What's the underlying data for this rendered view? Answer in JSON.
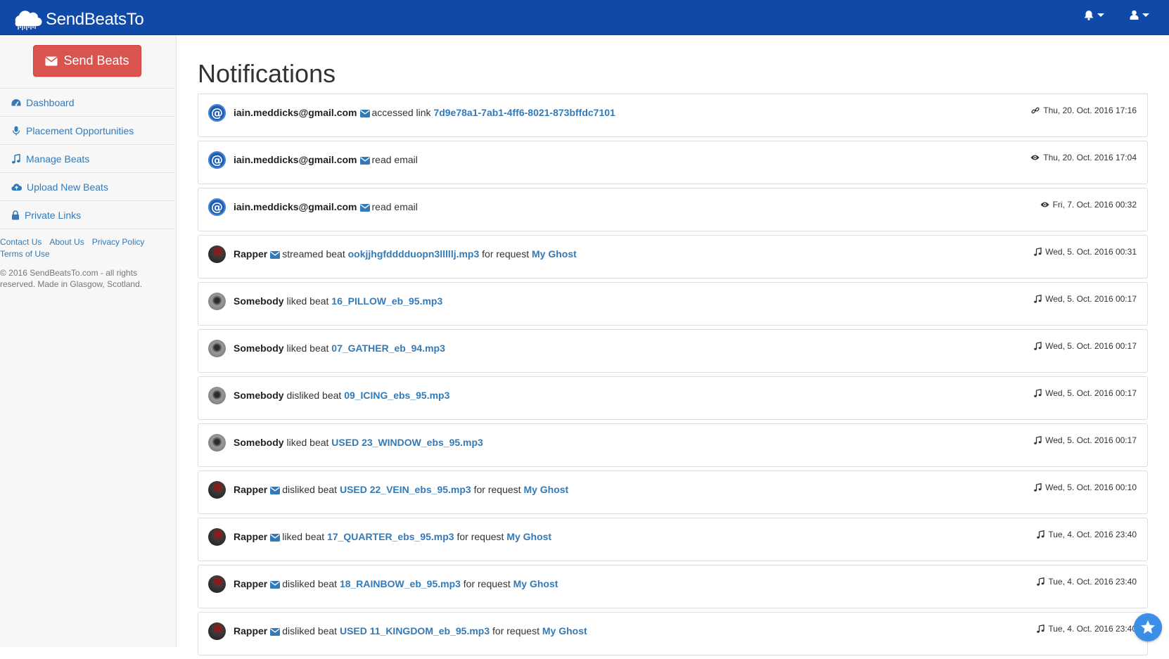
{
  "brand": {
    "name": "SendBeatsTo"
  },
  "topnav": {
    "notifications_icon": "bell-icon",
    "user_icon": "user-icon"
  },
  "sidebar": {
    "send_button": "Send Beats",
    "items": [
      {
        "label": "Dashboard",
        "icon": "dashboard-icon"
      },
      {
        "label": "Placement Opportunities",
        "icon": "microphone-icon"
      },
      {
        "label": "Manage Beats",
        "icon": "music-icon"
      },
      {
        "label": "Upload New Beats",
        "icon": "cloud-upload-icon"
      },
      {
        "label": "Private Links",
        "icon": "lock-icon"
      }
    ],
    "footer_links": [
      "Contact Us",
      "About Us",
      "Privacy Policy",
      "Terms of Use"
    ],
    "copyright": "© 2016 SendBeatsTo.com - all rights reserved. Made in Glasgow, Scotland."
  },
  "page": {
    "title": "Notifications"
  },
  "notifications": [
    {
      "avatar": "at",
      "user": "iain.meddicks@gmail.com",
      "mail": true,
      "action": "accessed link",
      "target": "7d9e78a1-7ab1-4ff6-8021-873bffdc7101",
      "for": "",
      "request": "",
      "stamp_icon": "link-icon",
      "date": "Thu, 20. Oct. 2016 17:16"
    },
    {
      "avatar": "at",
      "user": "iain.meddicks@gmail.com",
      "mail": true,
      "action": "read email",
      "target": "",
      "for": "",
      "request": "",
      "stamp_icon": "eye-icon",
      "date": "Thu, 20. Oct. 2016 17:04"
    },
    {
      "avatar": "at",
      "user": "iain.meddicks@gmail.com",
      "mail": true,
      "action": "read email",
      "target": "",
      "for": "",
      "request": "",
      "stamp_icon": "eye-icon",
      "date": "Fri, 7. Oct. 2016 00:32"
    },
    {
      "avatar": "rapper",
      "user": "Rapper",
      "mail": true,
      "action": "streamed beat",
      "target": "ookjjhgfdddduopn3lllllj.mp3",
      "for": "for request",
      "request": "My Ghost",
      "stamp_icon": "music-icon",
      "date": "Wed, 5. Oct. 2016 00:31"
    },
    {
      "avatar": "somebody",
      "user": "Somebody",
      "mail": false,
      "action": "liked beat",
      "target": "16_PILLOW_eb_95.mp3",
      "for": "",
      "request": "",
      "stamp_icon": "music-icon",
      "date": "Wed, 5. Oct. 2016 00:17"
    },
    {
      "avatar": "somebody",
      "user": "Somebody",
      "mail": false,
      "action": "liked beat",
      "target": "07_GATHER_eb_94.mp3",
      "for": "",
      "request": "",
      "stamp_icon": "music-icon",
      "date": "Wed, 5. Oct. 2016 00:17"
    },
    {
      "avatar": "somebody",
      "user": "Somebody",
      "mail": false,
      "action": "disliked beat",
      "target": "09_ICING_ebs_95.mp3",
      "for": "",
      "request": "",
      "stamp_icon": "music-icon",
      "date": "Wed, 5. Oct. 2016 00:17"
    },
    {
      "avatar": "somebody",
      "user": "Somebody",
      "mail": false,
      "action": "liked beat",
      "target": "USED 23_WINDOW_ebs_95.mp3",
      "for": "",
      "request": "",
      "stamp_icon": "music-icon",
      "date": "Wed, 5. Oct. 2016 00:17"
    },
    {
      "avatar": "rapper",
      "user": "Rapper",
      "mail": true,
      "action": "disliked beat",
      "target": "USED 22_VEIN_ebs_95.mp3",
      "for": "for request",
      "request": "My Ghost",
      "stamp_icon": "music-icon",
      "date": "Wed, 5. Oct. 2016 00:10"
    },
    {
      "avatar": "rapper",
      "user": "Rapper",
      "mail": true,
      "action": "liked beat",
      "target": "17_QUARTER_ebs_95.mp3",
      "for": "for request",
      "request": "My Ghost",
      "stamp_icon": "music-icon",
      "date": "Tue, 4. Oct. 2016 23:40"
    },
    {
      "avatar": "rapper",
      "user": "Rapper",
      "mail": true,
      "action": "disliked beat",
      "target": "18_RAINBOW_eb_95.mp3",
      "for": "for request",
      "request": "My Ghost",
      "stamp_icon": "music-icon",
      "date": "Tue, 4. Oct. 2016 23:40"
    },
    {
      "avatar": "rapper",
      "user": "Rapper",
      "mail": true,
      "action": "disliked beat",
      "target": "USED 11_KINGDOM_eb_95.mp3",
      "for": "for request",
      "request": "My Ghost",
      "stamp_icon": "music-icon",
      "date": "Tue, 4. Oct. 2016 23:40"
    }
  ],
  "floating_button": {
    "icon": "star-icon"
  }
}
